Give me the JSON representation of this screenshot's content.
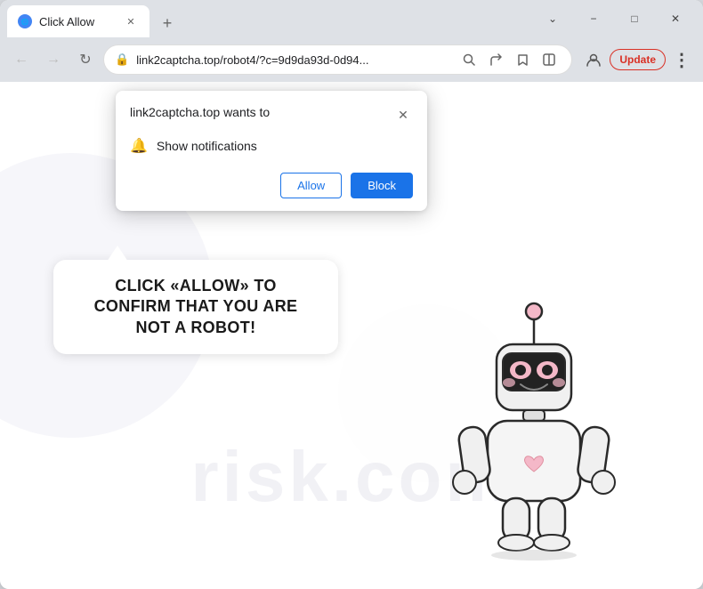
{
  "browser": {
    "tab_title": "Click Allow",
    "tab_favicon": "●",
    "new_tab_icon": "+",
    "close_tab_icon": "✕"
  },
  "window_controls": {
    "minimize": "−",
    "maximize": "□",
    "close": "✕",
    "chevron_down": "⌄",
    "kebab": "⋮"
  },
  "address_bar": {
    "url": "link2captcha.top/robot4/?c=9d9da93d-0d94...",
    "lock_icon": "🔒",
    "search_icon": "🔍",
    "share_icon": "↗",
    "star_icon": "☆",
    "split_icon": "⧉",
    "profile_icon": "👤",
    "update_label": "Update",
    "kebab_icon": "⋮"
  },
  "nav": {
    "back_icon": "←",
    "forward_icon": "→",
    "refresh_icon": "↻"
  },
  "notification_popup": {
    "title": "link2captcha.top wants to",
    "close_icon": "✕",
    "bell_icon": "🔔",
    "permission_text": "Show notifications",
    "allow_label": "Allow",
    "block_label": "Block"
  },
  "page": {
    "speech_text": "CLICK «ALLOW» TO CONFIRM THAT YOU ARE NOT A ROBOT!",
    "watermark": "risk.com"
  }
}
